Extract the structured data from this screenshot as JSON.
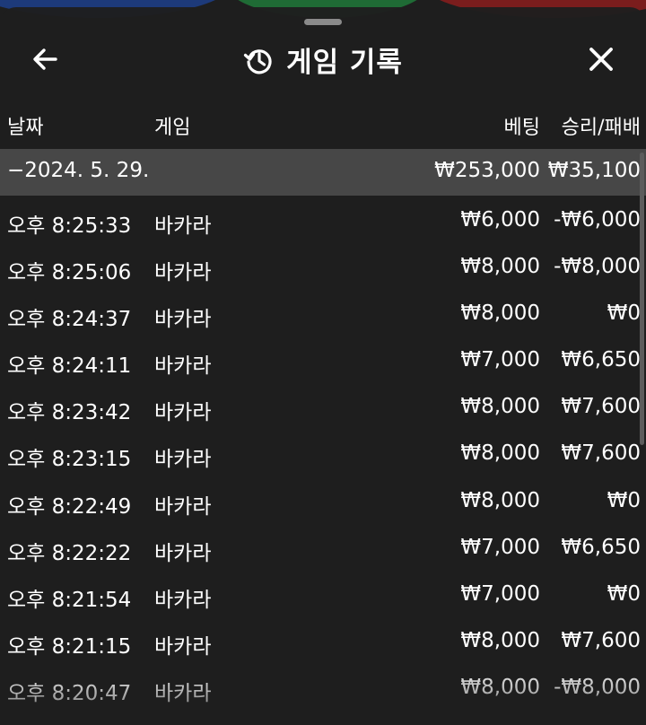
{
  "header": {
    "title": "게임 기록",
    "back_icon": "arrow-left-icon",
    "history_icon": "history-icon",
    "close_icon": "close-icon"
  },
  "columns": {
    "date": "날짜",
    "game": "게임",
    "bet": "베팅",
    "result": "승리/패배"
  },
  "group": {
    "date": "−2024. 5. 29.",
    "bet_total": "₩253,000",
    "result_total": "₩35,100"
  },
  "rows": [
    {
      "time": "오후 8:25:33",
      "game": "바카라",
      "bet": "₩6,000",
      "result": "-₩6,000"
    },
    {
      "time": "오후 8:25:06",
      "game": "바카라",
      "bet": "₩8,000",
      "result": "-₩8,000"
    },
    {
      "time": "오후 8:24:37",
      "game": "바카라",
      "bet": "₩8,000",
      "result": "₩0"
    },
    {
      "time": "오후 8:24:11",
      "game": "바카라",
      "bet": "₩7,000",
      "result": "₩6,650"
    },
    {
      "time": "오후 8:23:42",
      "game": "바카라",
      "bet": "₩8,000",
      "result": "₩7,600"
    },
    {
      "time": "오후 8:23:15",
      "game": "바카라",
      "bet": "₩8,000",
      "result": "₩7,600"
    },
    {
      "time": "오후 8:22:49",
      "game": "바카라",
      "bet": "₩8,000",
      "result": "₩0"
    },
    {
      "time": "오후 8:22:22",
      "game": "바카라",
      "bet": "₩7,000",
      "result": "₩6,650"
    },
    {
      "time": "오후 8:21:54",
      "game": "바카라",
      "bet": "₩7,000",
      "result": "₩0"
    },
    {
      "time": "오후 8:21:15",
      "game": "바카라",
      "bet": "₩8,000",
      "result": "₩7,600"
    },
    {
      "time": "오후 8:20:47",
      "game": "바카라",
      "bet": "₩8,000",
      "result": "-₩8,000"
    }
  ],
  "colors": {
    "sheet_bg": "#1e1e1e",
    "group_bg": "#474747",
    "text": "#ffffff"
  }
}
